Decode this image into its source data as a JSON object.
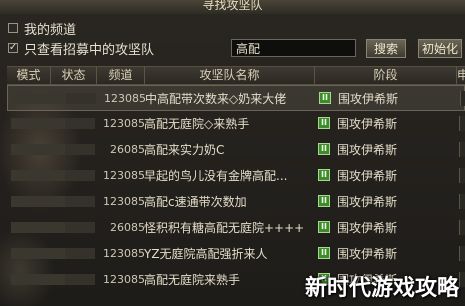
{
  "window": {
    "title": "寻找攻坚队"
  },
  "options": {
    "my_channel": {
      "label": "我的频道",
      "checked": false
    },
    "recruiting_only": {
      "label": "只查看招募中的攻坚队",
      "checked": true
    }
  },
  "search": {
    "value": "高配",
    "button_label": "搜索",
    "reset_label": "初始化"
  },
  "columns": [
    "模式",
    "状态",
    "频道",
    "攻坚队名称",
    "阶段",
    "申"
  ],
  "rows": [
    {
      "channel": "123085",
      "name": "中高配带次数来◇奶来大佬",
      "stage": "围攻伊希斯",
      "selected": true
    },
    {
      "channel": "123085",
      "name": "高配无庭院◇来熟手",
      "stage": "围攻伊希斯",
      "selected": false
    },
    {
      "channel": "26085",
      "name": "高配来实力奶C",
      "stage": "围攻伊希斯",
      "selected": false
    },
    {
      "channel": "123085",
      "name": "早起的鸟儿没有金牌高配...",
      "stage": "围攻伊希斯",
      "selected": false
    },
    {
      "channel": "123085",
      "name": "高配c速通带次数加",
      "stage": "围攻伊希斯",
      "selected": false
    },
    {
      "channel": "26085",
      "name": "怪积积有糖高配无庭院++++",
      "stage": "围攻伊希斯",
      "selected": false
    },
    {
      "channel": "123085",
      "name": "YZ无庭院高配强折来人",
      "stage": "围攻伊希斯",
      "selected": false
    },
    {
      "channel": "123085",
      "name": "高配无庭院来熟手",
      "stage": "围攻伊希斯",
      "selected": false
    }
  ],
  "status_icon": "II",
  "watermark": "新时代游戏攻略"
}
